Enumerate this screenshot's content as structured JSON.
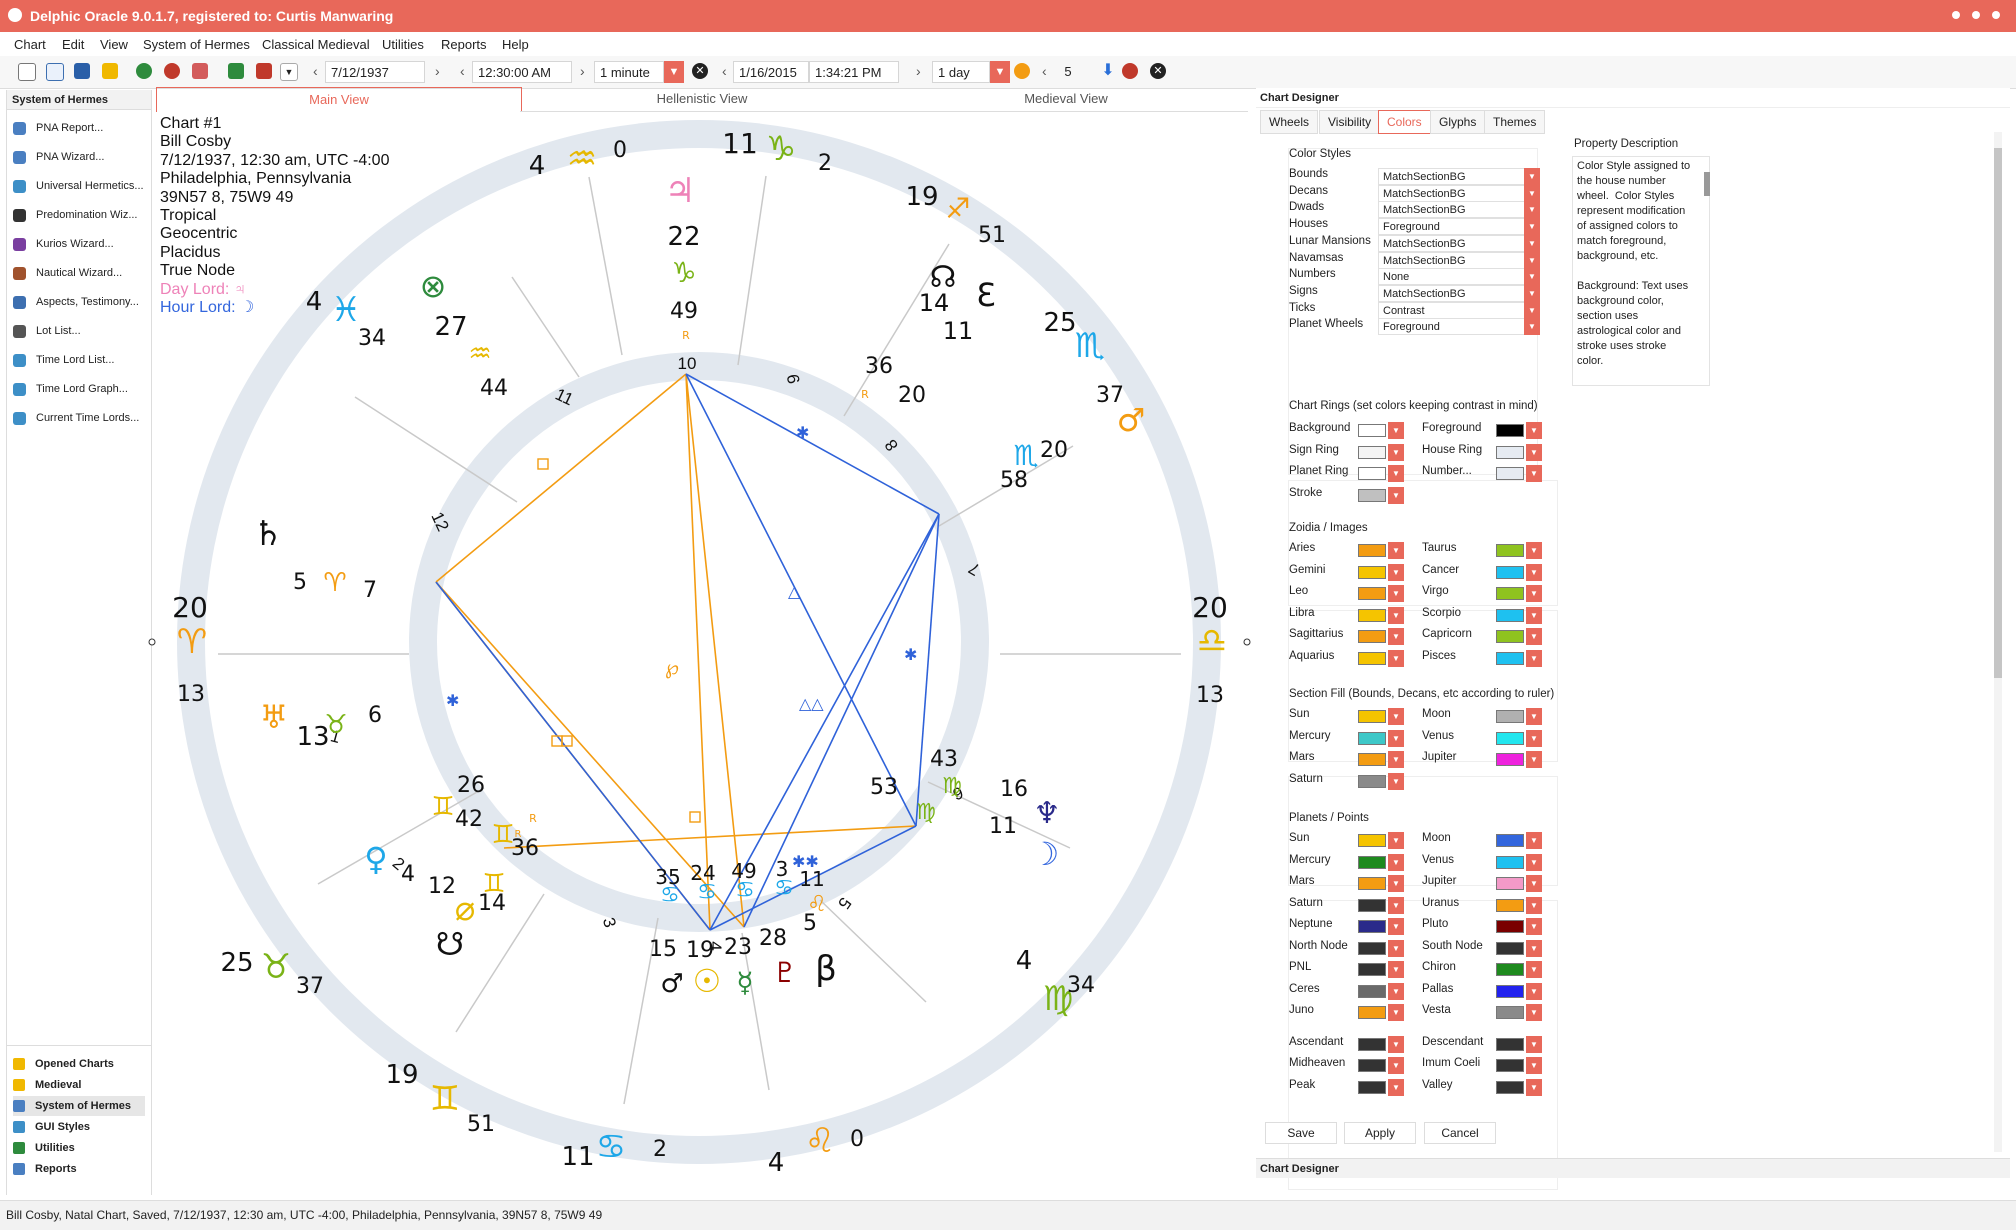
{
  "window": {
    "title": "Delphic Oracle 9.0.1.7, registered to: Curtis Manwaring"
  },
  "menu": [
    "Chart",
    "Edit",
    "View",
    "System of Hermes",
    "Classical Medieval",
    "Utilities",
    "Reports",
    "Help"
  ],
  "toolbar": {
    "date1": "7/12/1937",
    "time1": "12:30:00 AM",
    "step1": "1 minute",
    "date2": "1/16/2015",
    "time2": "1:34:21 PM",
    "step2": "1 day",
    "count": "5"
  },
  "left_panel": {
    "title": "System of Hermes",
    "items": [
      {
        "label": "PNA Report...",
        "color": "#4a7fc1"
      },
      {
        "label": "PNA Wizard...",
        "color": "#4a7fc1"
      },
      {
        "label": "Universal Hermetics...",
        "color": "#3d8fc7"
      },
      {
        "label": "Predomination Wiz...",
        "color": "#333333"
      },
      {
        "label": "Kurios Wizard...",
        "color": "#7a3fa0"
      },
      {
        "label": "Nautical Wizard...",
        "color": "#a0522d"
      },
      {
        "label": "Aspects, Testimony...",
        "color": "#3d6fb0"
      },
      {
        "label": "Lot List...",
        "color": "#555555"
      },
      {
        "label": "Time Lord List...",
        "color": "#3d8fc7"
      },
      {
        "label": "Time Lord Graph...",
        "color": "#3d8fc7"
      },
      {
        "label": "Current Time Lords...",
        "color": "#3d8fc7"
      }
    ],
    "nav": [
      {
        "label": "Opened Charts",
        "color": "#f0b800"
      },
      {
        "label": "Medieval",
        "color": "#f0b800"
      },
      {
        "label": "System of Hermes",
        "color": "#4a7fc1"
      },
      {
        "label": "GUI Styles",
        "color": "#3d8fc7"
      },
      {
        "label": "Utilities",
        "color": "#2e8b3d"
      },
      {
        "label": "Reports",
        "color": "#4a7fc1"
      }
    ]
  },
  "views": [
    "Main View",
    "Hellenistic View",
    "Medieval View"
  ],
  "chart_info": {
    "lines": [
      "Chart #1",
      "Bill Cosby",
      "7/12/1937, 12:30 am, UTC -4:00",
      "Philadelphia, Pennsylvania",
      "39N57 8, 75W9 49",
      "Tropical",
      "Geocentric",
      "Placidus",
      "True Node"
    ],
    "day_lord": "Day Lord: ♃",
    "hour_lord": "Hour Lord: ☽"
  },
  "wheel": {
    "house_numbers": [
      "1",
      "2",
      "3",
      "4",
      "5",
      "6",
      "7",
      "8",
      "9",
      "10",
      "11",
      "12"
    ],
    "labels": [
      {
        "t": "4",
        "c": "#111"
      },
      {
        "t": "♒",
        "c": "#e6b800"
      },
      {
        "t": "0",
        "c": "#111"
      },
      {
        "t": "11",
        "c": "#111"
      },
      {
        "t": "♑",
        "c": "#7ab317"
      },
      {
        "t": "2",
        "c": "#111"
      },
      {
        "t": "19",
        "c": "#111"
      },
      {
        "t": "♐",
        "c": "#f39c12"
      },
      {
        "t": "51",
        "c": "#111"
      },
      {
        "t": "25",
        "c": "#111"
      },
      {
        "t": "♏",
        "c": "#1ea7e8"
      },
      {
        "t": "37",
        "c": "#111"
      },
      {
        "t": "20",
        "c": "#111"
      },
      {
        "t": "♎",
        "c": "#e6b800"
      },
      {
        "t": "13",
        "c": "#111"
      },
      {
        "t": "4",
        "c": "#111"
      },
      {
        "t": "♍",
        "c": "#7ab317"
      },
      {
        "t": "34",
        "c": "#111"
      },
      {
        "t": "4",
        "c": "#111"
      },
      {
        "t": "♌",
        "c": "#f39c12"
      },
      {
        "t": "0",
        "c": "#111"
      },
      {
        "t": "11",
        "c": "#111"
      },
      {
        "t": "♋",
        "c": "#1ea7e8"
      },
      {
        "t": "2",
        "c": "#111"
      },
      {
        "t": "19",
        "c": "#111"
      },
      {
        "t": "♊",
        "c": "#e6b800"
      },
      {
        "t": "51",
        "c": "#111"
      },
      {
        "t": "25",
        "c": "#111"
      },
      {
        "t": "♉",
        "c": "#7ab317"
      },
      {
        "t": "37",
        "c": "#111"
      },
      {
        "t": "20",
        "c": "#111"
      },
      {
        "t": "♈",
        "c": "#f39c12"
      },
      {
        "t": "13",
        "c": "#111"
      },
      {
        "t": "4",
        "c": "#111"
      },
      {
        "t": "♓",
        "c": "#1ea7e8"
      },
      {
        "t": "34",
        "c": "#111"
      },
      {
        "t": "♃",
        "c": "#ee82b8"
      },
      {
        "t": "22",
        "c": "#111"
      },
      {
        "t": "♑",
        "c": "#7ab317"
      },
      {
        "t": "49",
        "c": "#111"
      },
      {
        "t": "R",
        "c": "#f39c12"
      },
      {
        "t": "☊",
        "c": "#111"
      },
      {
        "t": "ℇ",
        "c": "#111"
      },
      {
        "t": "14",
        "c": "#111"
      },
      {
        "t": "11",
        "c": "#111"
      },
      {
        "t": "36",
        "c": "#111"
      },
      {
        "t": "R",
        "c": "#f39c12"
      },
      {
        "t": "20",
        "c": "#111"
      },
      {
        "t": "♂",
        "c": "#f39c12"
      },
      {
        "t": "20",
        "c": "#111"
      },
      {
        "t": "♏",
        "c": "#1ea7e8"
      },
      {
        "t": "58",
        "c": "#111"
      },
      {
        "t": "⊗",
        "c": "#2e8b3d"
      },
      {
        "t": "27",
        "c": "#111"
      },
      {
        "t": "♒",
        "c": "#e6b800"
      },
      {
        "t": "44",
        "c": "#111"
      },
      {
        "t": "♄",
        "c": "#111"
      },
      {
        "t": "5",
        "c": "#111"
      },
      {
        "t": "♈",
        "c": "#f39c12"
      },
      {
        "t": "7",
        "c": "#111"
      },
      {
        "t": "♅",
        "c": "#f39c12"
      },
      {
        "t": "13",
        "c": "#111"
      },
      {
        "t": "♉",
        "c": "#7ab317"
      },
      {
        "t": "6",
        "c": "#111"
      },
      {
        "t": "26",
        "c": "#111"
      },
      {
        "t": "♊",
        "c": "#e6b800"
      },
      {
        "t": "42",
        "c": "#111"
      },
      {
        "t": "R",
        "c": "#f39c12"
      },
      {
        "t": "♊",
        "c": "#e6b800"
      },
      {
        "t": "36",
        "c": "#111"
      },
      {
        "t": "♀",
        "c": "#1ea7e8"
      },
      {
        "t": "4",
        "c": "#111"
      },
      {
        "t": "12",
        "c": "#111"
      },
      {
        "t": "⌀",
        "c": "#e6b800"
      },
      {
        "t": "♊",
        "c": "#e6b800"
      },
      {
        "t": "14",
        "c": "#111"
      },
      {
        "t": "☋",
        "c": "#111"
      },
      {
        "t": "35",
        "c": "#111"
      },
      {
        "t": "24",
        "c": "#111"
      },
      {
        "t": "49",
        "c": "#111"
      },
      {
        "t": "3",
        "c": "#111"
      },
      {
        "t": "11",
        "c": "#111"
      },
      {
        "t": "♋",
        "c": "#1ea7e8"
      },
      {
        "t": "♋",
        "c": "#1ea7e8"
      },
      {
        "t": "♋",
        "c": "#1ea7e8"
      },
      {
        "t": "♋",
        "c": "#1ea7e8"
      },
      {
        "t": "♌",
        "c": "#f39c12"
      },
      {
        "t": "15",
        "c": "#111"
      },
      {
        "t": "19",
        "c": "#111"
      },
      {
        "t": "23",
        "c": "#111"
      },
      {
        "t": "28",
        "c": "#111"
      },
      {
        "t": "5",
        "c": "#111"
      },
      {
        "t": "♂",
        "c": "#111"
      },
      {
        "t": "☉",
        "c": "#e6b800"
      },
      {
        "t": "☿",
        "c": "#2e8b3d"
      },
      {
        "t": "♇",
        "c": "#8b0000"
      },
      {
        "t": "β",
        "c": "#111"
      },
      {
        "t": "43",
        "c": "#111"
      },
      {
        "t": "♍",
        "c": "#7ab317"
      },
      {
        "t": "53",
        "c": "#111"
      },
      {
        "t": "♍",
        "c": "#7ab317"
      },
      {
        "t": "16",
        "c": "#111"
      },
      {
        "t": "♆",
        "c": "#2a2a8a"
      },
      {
        "t": "11",
        "c": "#111"
      },
      {
        "t": "☽",
        "c": "#3366dd"
      },
      {
        "t": "R",
        "c": "#f39c12"
      },
      {
        "t": "℘",
        "c": "#f39c12"
      }
    ]
  },
  "designer": {
    "title": "Chart Designer",
    "tabs": [
      "Wheels",
      "Visibility",
      "Colors",
      "Glyphs",
      "Themes"
    ],
    "active_tab": "Colors",
    "property_title": "Property Description",
    "property_text": "Color Style assigned to the house number wheel.  Color Styles represent modification of assigned colors to match foreground, background, etc.\n\nBackground: Text uses background color, section uses astrological color and stroke uses stroke color.",
    "color_styles_title": "Color Styles",
    "color_styles": [
      {
        "label": "Bounds",
        "value": "MatchSectionBG"
      },
      {
        "label": "Decans",
        "value": "MatchSectionBG"
      },
      {
        "label": "Dwads",
        "value": "MatchSectionBG"
      },
      {
        "label": "Houses",
        "value": "Foreground"
      },
      {
        "label": "Lunar Mansions",
        "value": "MatchSectionBG"
      },
      {
        "label": "Navamsas",
        "value": "MatchSectionBG"
      },
      {
        "label": "Numbers",
        "value": "None"
      },
      {
        "label": "Signs",
        "value": "MatchSectionBG"
      },
      {
        "label": "Ticks",
        "value": "Contrast"
      },
      {
        "label": "Planet Wheels",
        "value": "Foreground"
      }
    ],
    "chart_rings_title": "Chart Rings (set colors keeping contrast in mind)",
    "chart_rings": [
      {
        "label": "Background",
        "color": "#ffffff"
      },
      {
        "label": "Foreground",
        "color": "#000000"
      },
      {
        "label": "Sign Ring",
        "color": "#f4f4f4"
      },
      {
        "label": "House Ring",
        "color": "#e6ebf2"
      },
      {
        "label": "Planet Ring",
        "color": "#ffffff"
      },
      {
        "label": "Number...",
        "color": "#e6ebf2"
      },
      {
        "label": "Stroke",
        "color": "#c0c0c0"
      }
    ],
    "zoidia_title": "Zoidia / Images",
    "zoidia": [
      {
        "label": "Aries",
        "color": "#f39c12"
      },
      {
        "label": "Taurus",
        "color": "#8fc31f"
      },
      {
        "label": "Gemini",
        "color": "#f5c400"
      },
      {
        "label": "Cancer",
        "color": "#1ec1f0"
      },
      {
        "label": "Leo",
        "color": "#f39c12"
      },
      {
        "label": "Virgo",
        "color": "#8fc31f"
      },
      {
        "label": "Libra",
        "color": "#f5c400"
      },
      {
        "label": "Scorpio",
        "color": "#1ec1f0"
      },
      {
        "label": "Sagittarius",
        "color": "#f39c12"
      },
      {
        "label": "Capricorn",
        "color": "#8fc31f"
      },
      {
        "label": "Aquarius",
        "color": "#f5c400"
      },
      {
        "label": "Pisces",
        "color": "#1ec1f0"
      }
    ],
    "section_fill_title": "Section Fill (Bounds, Decans, etc according to ruler)",
    "section_fill": [
      {
        "label": "Sun",
        "color": "#f5c400"
      },
      {
        "label": "Moon",
        "color": "#b0b0b0"
      },
      {
        "label": "Mercury",
        "color": "#3ec8c8"
      },
      {
        "label": "Venus",
        "color": "#22e6ee"
      },
      {
        "label": "Mars",
        "color": "#f39c12"
      },
      {
        "label": "Jupiter",
        "color": "#ee22dd"
      },
      {
        "label": "Saturn",
        "color": "#8a8a8a"
      }
    ],
    "planets_title": "Planets / Points",
    "planets": [
      {
        "label": "Sun",
        "color": "#f5c400"
      },
      {
        "label": "Moon",
        "color": "#3366dd"
      },
      {
        "label": "Mercury",
        "color": "#1e8a1e"
      },
      {
        "label": "Venus",
        "color": "#1ec1f0"
      },
      {
        "label": "Mars",
        "color": "#f39c12"
      },
      {
        "label": "Jupiter",
        "color": "#f39ac8"
      },
      {
        "label": "Saturn",
        "color": "#333333"
      },
      {
        "label": "Uranus",
        "color": "#f39c12"
      },
      {
        "label": "Neptune",
        "color": "#2a2a8a"
      },
      {
        "label": "Pluto",
        "color": "#7a0000"
      },
      {
        "label": "North Node",
        "color": "#333333"
      },
      {
        "label": "South Node",
        "color": "#333333"
      },
      {
        "label": "PNL",
        "color": "#333333"
      },
      {
        "label": "Chiron",
        "color": "#1e8a1e"
      },
      {
        "label": "Ceres",
        "color": "#6a6a6a"
      },
      {
        "label": "Pallas",
        "color": "#2222ee"
      },
      {
        "label": "Juno",
        "color": "#f39c12"
      },
      {
        "label": "Vesta",
        "color": "#8a8a8a"
      },
      {
        "label": "Ascendant",
        "color": "#333333"
      },
      {
        "label": "Descendant",
        "color": "#333333"
      },
      {
        "label": "Midheaven",
        "color": "#333333"
      },
      {
        "label": "Imum Coeli",
        "color": "#333333"
      },
      {
        "label": "Peak",
        "color": "#333333"
      },
      {
        "label": "Valley",
        "color": "#333333"
      }
    ],
    "buttons": [
      "Save",
      "Apply",
      "Cancel"
    ],
    "footer_title": "Chart Designer"
  },
  "status": "Bill Cosby, Natal Chart, Saved, 7/12/1937, 12:30 am, UTC -4:00, Philadelphia, Pennsylvania, 39N57 8, 75W9 49"
}
